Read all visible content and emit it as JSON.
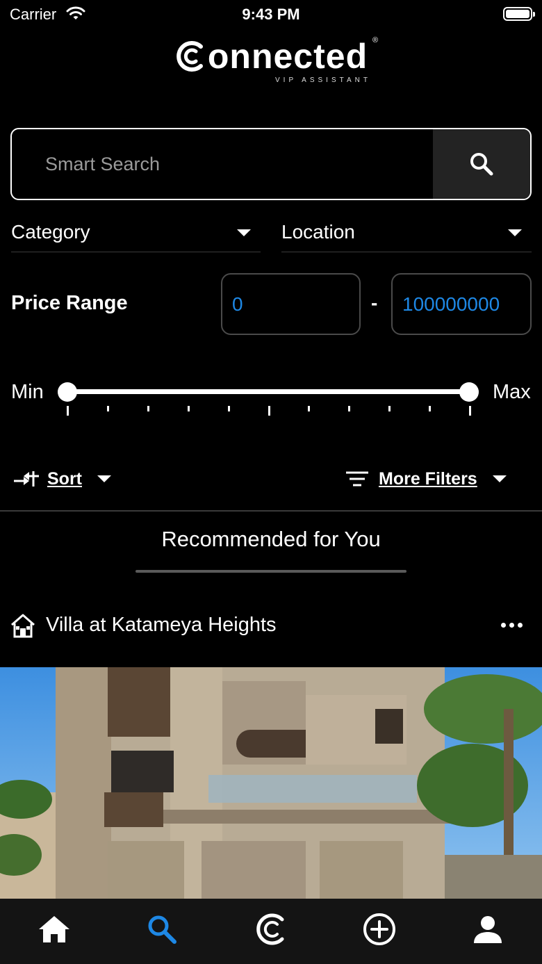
{
  "status_bar": {
    "carrier": "Carrier",
    "time": "9:43 PM"
  },
  "logo": {
    "wordmark": "onnected",
    "registered": "®",
    "tagline": "VIP ASSISTANT"
  },
  "search": {
    "placeholder": "Smart Search"
  },
  "filters": {
    "category_label": "Category",
    "location_label": "Location",
    "price_range_label": "Price Range",
    "price_min": "0",
    "price_max": "100000000",
    "price_separator": "-",
    "slider": {
      "min_label": "Min",
      "max_label": "Max",
      "low_fraction": 0,
      "high_fraction": 1,
      "tick_count": 11
    },
    "sort_label": "Sort",
    "more_filters_label": "More Filters"
  },
  "tabs": [
    {
      "label": "Recommended for You",
      "active": true
    }
  ],
  "listing": {
    "title": "Villa at Katameya Heights"
  },
  "bottom_nav": {
    "items": [
      "home-icon",
      "search-icon",
      "connected-logo-icon",
      "add-circle-icon",
      "profile-icon"
    ],
    "active_color": "#1e88e5",
    "inactive_color": "#ffffff"
  },
  "colors": {
    "background": "#000000",
    "accent": "#1e88e5",
    "search_button": "#232323"
  }
}
